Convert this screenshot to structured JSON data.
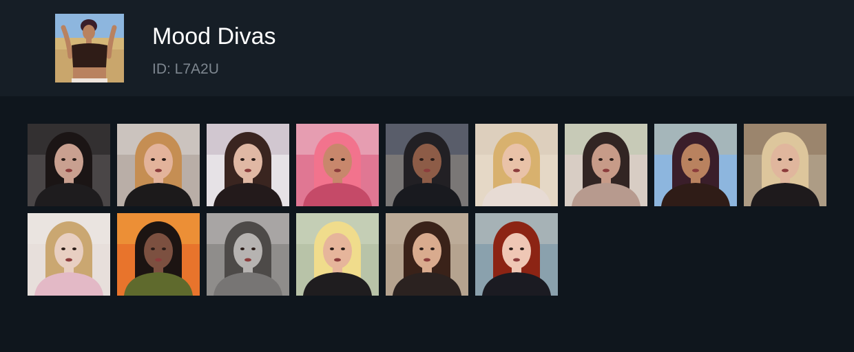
{
  "header": {
    "title": "Mood Divas",
    "id_label": "ID: L7A2U",
    "cover_icon": "woman-crop-top-photo-icon"
  },
  "stickers": [
    {
      "name": "sticker-sunglasses-woman",
      "bg": "#4a4647",
      "skin": "#c9a090",
      "hair": "#1b1515",
      "shirt": "#1e1c1e",
      "accent": "#0a0a0a"
    },
    {
      "name": "sticker-crying-blonde",
      "bg": "#b9aea7",
      "skin": "#e3b39b",
      "hair": "#c58e53",
      "shirt": "#1c1a1b",
      "accent": "#efeaea"
    },
    {
      "name": "sticker-brunette-smile",
      "bg": "#e6e2e6",
      "skin": "#e0b8a4",
      "hair": "#3a2520",
      "shirt": "#231a1b",
      "accent": "#a896a5"
    },
    {
      "name": "sticker-pink-hair-point",
      "bg": "#e07793",
      "skin": "#c8876c",
      "hair": "#f2738d",
      "shirt": "#c54a68",
      "accent": "#f0e6ea"
    },
    {
      "name": "sticker-shocked-headscarf",
      "bg": "#7a7776",
      "skin": "#8d5c47",
      "hair": "#222024",
      "shirt": "#191a1f",
      "accent": "#1e2f55"
    },
    {
      "name": "sticker-blonde-in-bed",
      "bg": "#e5d8c6",
      "skin": "#e9c2a8",
      "hair": "#d8b16e",
      "shirt": "#e7dbd4",
      "accent": "#cfc1ad"
    },
    {
      "name": "sticker-money-cash",
      "bg": "#d8cdc4",
      "skin": "#c79b88",
      "hair": "#322523",
      "shirt": "#b79a8e",
      "accent": "#a8c6a1"
    },
    {
      "name": "sticker-crop-top-dance",
      "bg": "#8db6de",
      "skin": "#b9825f",
      "hair": "#3a1e2a",
      "shirt": "#2f1c17",
      "accent": "#d5b778"
    },
    {
      "name": "sticker-wine-glass-blonde",
      "bg": "#ad9c85",
      "skin": "#e0b69d",
      "hair": "#ddc69c",
      "shirt": "#1e1a1c",
      "accent": "#7a5c43"
    },
    {
      "name": "sticker-face-mask-drink",
      "bg": "#e7dfdb",
      "skin": "#e8cfc2",
      "hair": "#caa771",
      "shirt": "#e3b9c6",
      "accent": "#f2eeec"
    },
    {
      "name": "sticker-explosion-fur-coat",
      "bg": "#e8742c",
      "skin": "#7c5040",
      "hair": "#1c1412",
      "shirt": "#5f6a2d",
      "accent": "#f4c24a"
    },
    {
      "name": "sticker-black-white-woman",
      "bg": "#8f8d8b",
      "skin": "#b6b3b1",
      "hair": "#4d4a48",
      "shirt": "#777574",
      "accent": "#d7d5d3"
    },
    {
      "name": "sticker-bratz-doll",
      "bg": "#b8c3a8",
      "skin": "#e6b59b",
      "hair": "#f0dc8c",
      "shirt": "#1f1d1f",
      "accent": "#dbe1ce"
    },
    {
      "name": "sticker-ponytail-eye-roll",
      "bg": "#b5a38f",
      "skin": "#d9ab8e",
      "hair": "#3a2219",
      "shirt": "#2b2220",
      "accent": "#c9bba9"
    },
    {
      "name": "sticker-redhead-stressed",
      "bg": "#8aa1ad",
      "skin": "#efc7b5",
      "hair": "#8c2414",
      "shirt": "#1b1b22",
      "accent": "#d9d2c9"
    }
  ]
}
